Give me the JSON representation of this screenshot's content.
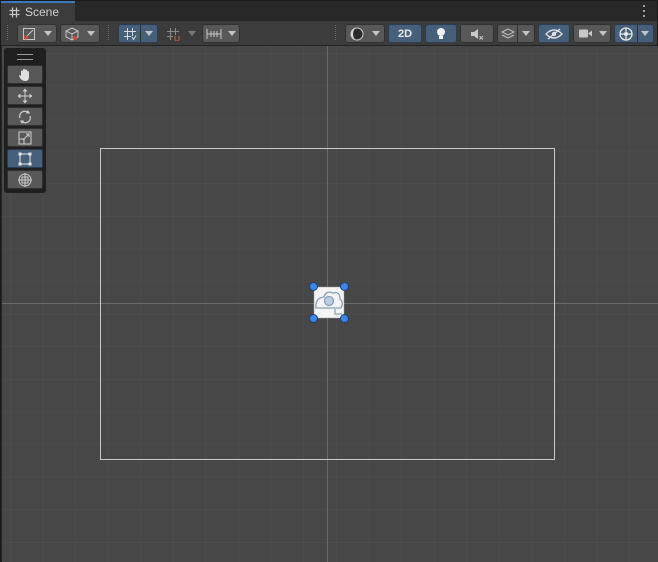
{
  "tab": {
    "label": "Scene",
    "icon": "grid-tab-icon"
  },
  "window": {
    "menu_icon": "kebab-menu-icon"
  },
  "toolbar": {
    "draw_mode": {
      "icon": "draw-mode-icon",
      "has_dropdown": true
    },
    "render_mode": {
      "icon": "shaded-cube-icon",
      "has_dropdown": true
    },
    "grid_visibility": {
      "icon": "grid-toggle-icon",
      "active": true,
      "has_dropdown": true
    },
    "grid_snapping": {
      "icon": "grid-snap-icon",
      "active": false,
      "has_dropdown": true
    },
    "increment_snap": {
      "icon": "increment-snap-icon",
      "has_dropdown": true
    },
    "shading": {
      "icon": "shading-sphere-icon",
      "has_dropdown": true
    },
    "mode_2d": {
      "label": "2D",
      "active": true
    },
    "lighting": {
      "icon": "lightbulb-icon",
      "active": true
    },
    "audio": {
      "icon": "audio-mute-icon",
      "active": false
    },
    "effects": {
      "icon": "effects-layers-icon",
      "has_dropdown": true
    },
    "hidden_objects": {
      "icon": "visibility-eye-icon",
      "active": true
    },
    "camera": {
      "icon": "camera-icon",
      "has_dropdown": true
    },
    "gizmos": {
      "icon": "gizmos-globe-icon",
      "active": true,
      "has_dropdown": true
    }
  },
  "tools_overlay": {
    "tools": [
      {
        "name": "hand",
        "icon": "hand-tool-icon",
        "active": false
      },
      {
        "name": "move",
        "icon": "move-tool-icon",
        "active": false
      },
      {
        "name": "rotate",
        "icon": "rotate-tool-icon",
        "active": false
      },
      {
        "name": "scale",
        "icon": "scale-tool-icon",
        "active": false
      },
      {
        "name": "rect",
        "icon": "rect-tool-icon",
        "active": true
      },
      {
        "name": "transform",
        "icon": "transform-tool-icon",
        "active": false
      }
    ]
  },
  "scene": {
    "camera_frame": "camera-view-frame",
    "selected_object_icon": "camera-gizmo-icon"
  },
  "colors": {
    "viewport_bg": "#474747",
    "toolbar_bg": "#3c3c3c",
    "active_blue": "#46607c",
    "tab_accent": "#3a79bb",
    "handle_blue": "#3d86e8"
  }
}
